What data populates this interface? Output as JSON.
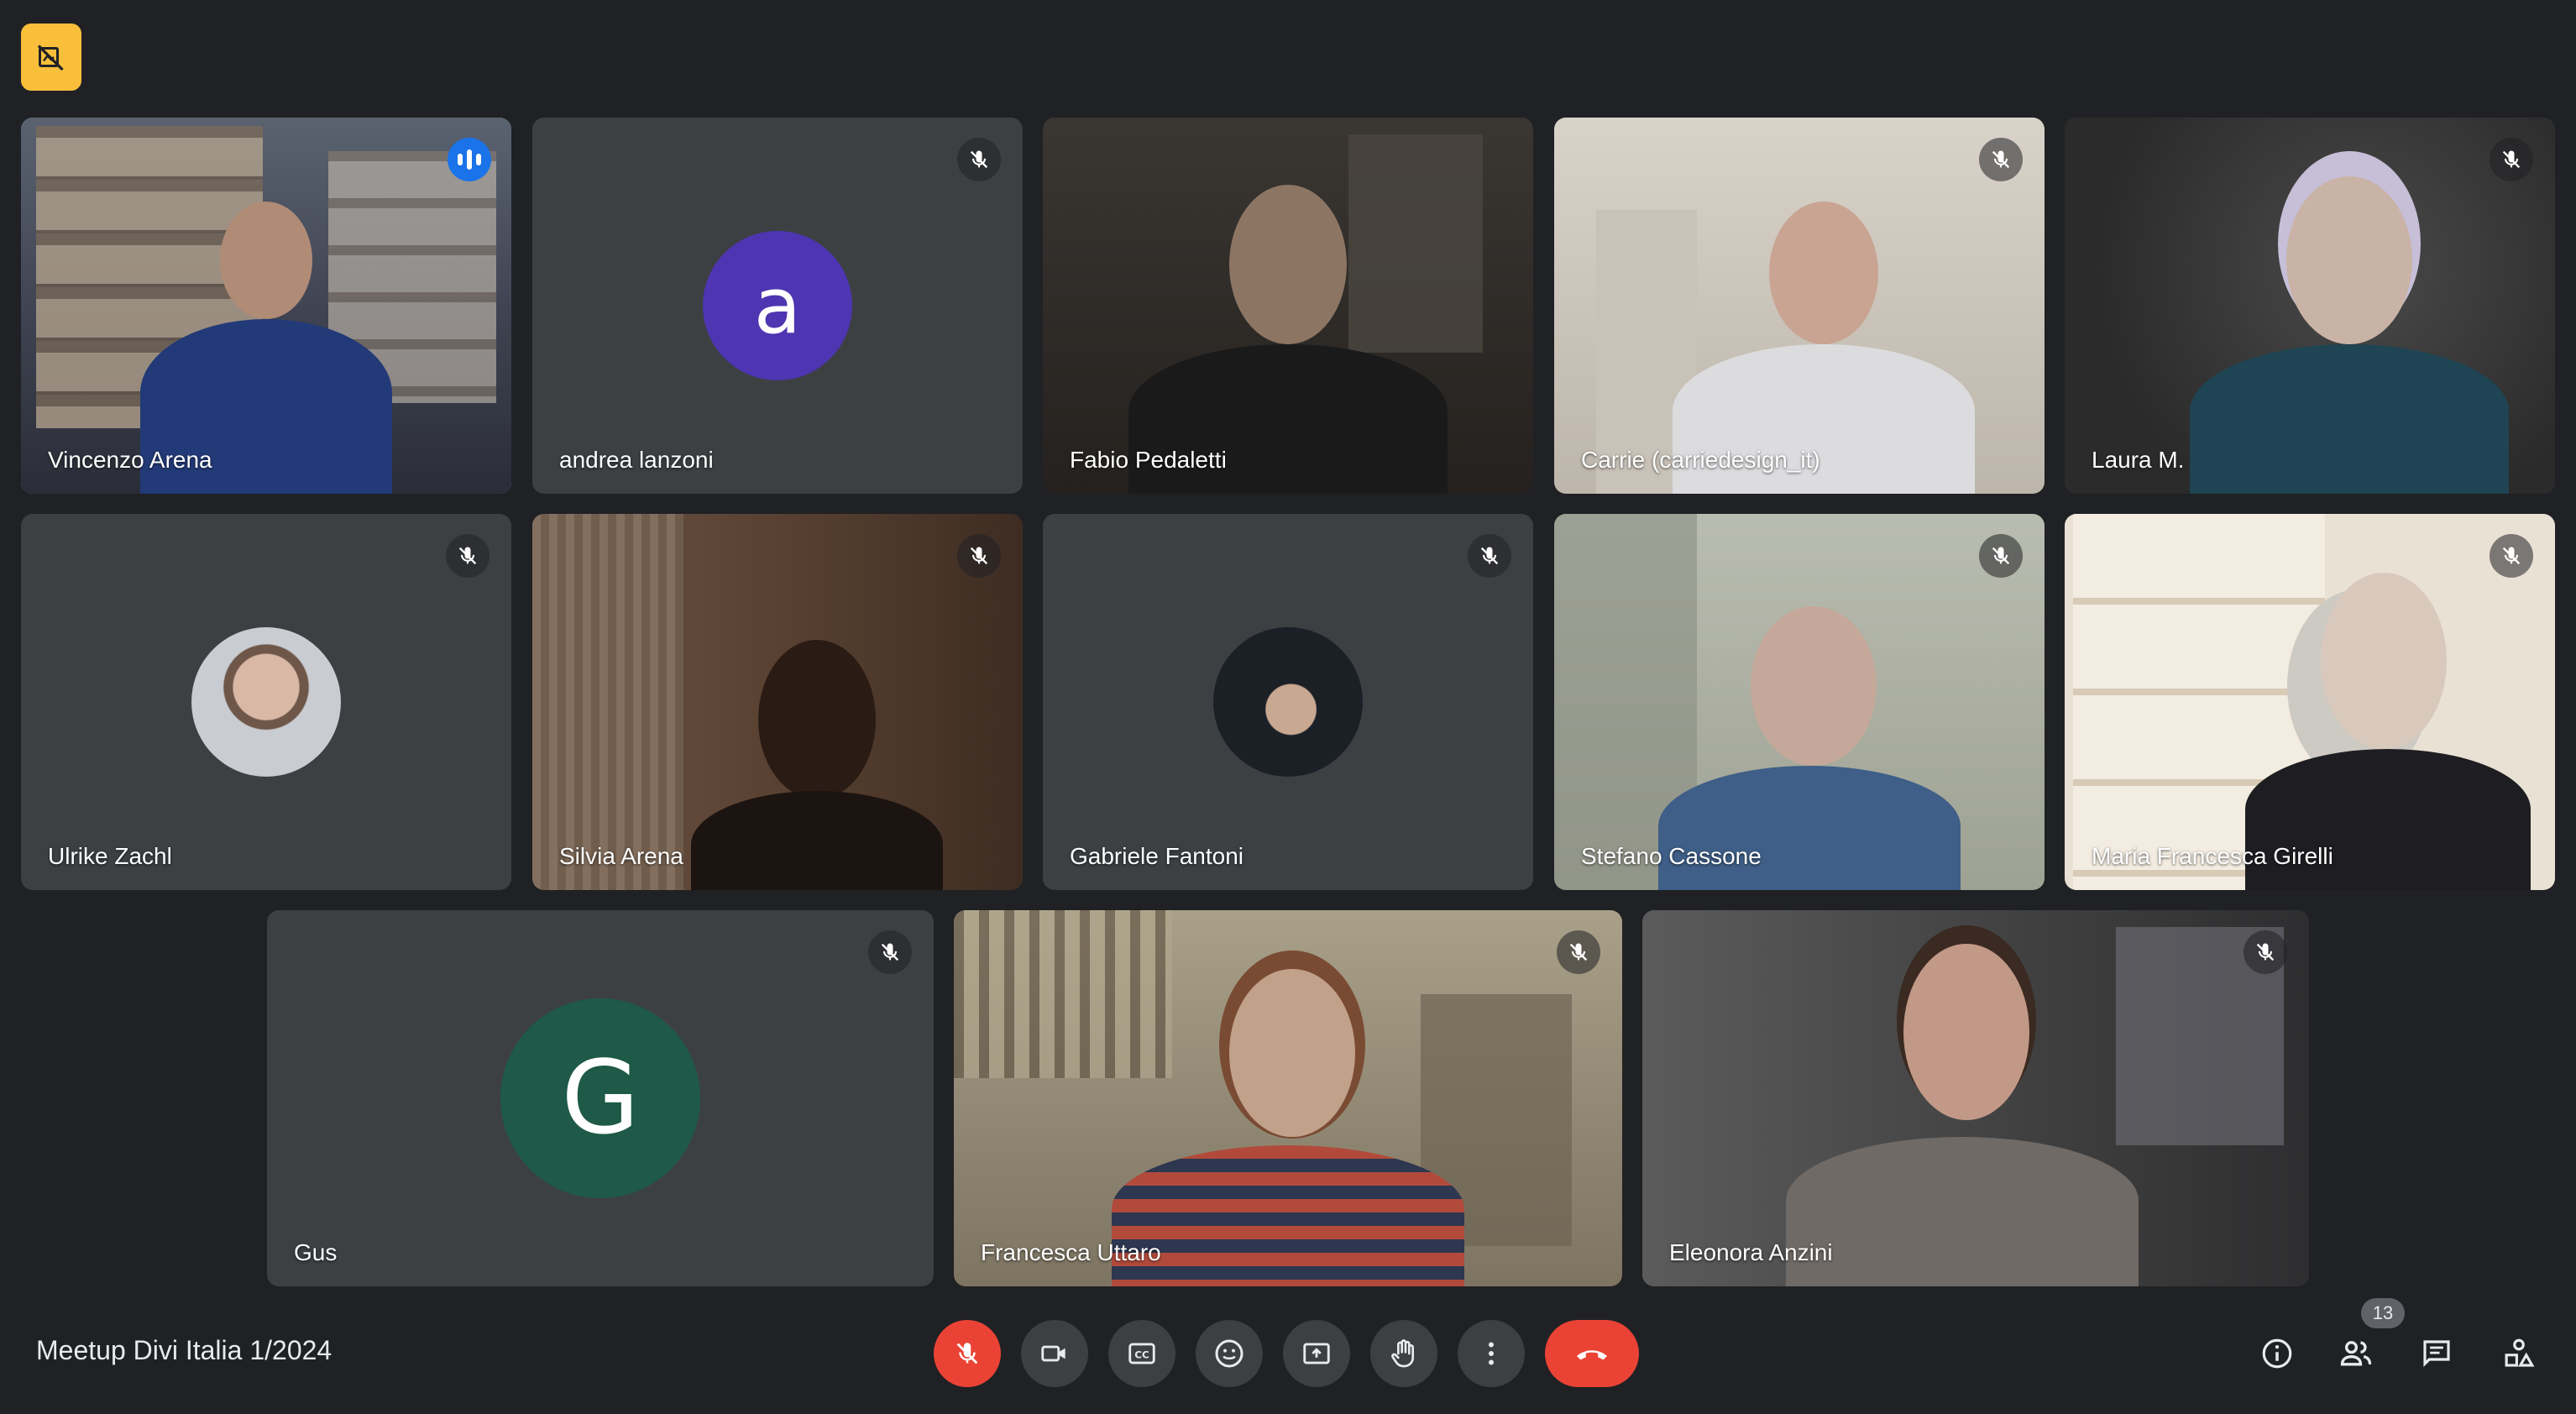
{
  "meeting": {
    "title": "Meetup Divi Italia 1/2024",
    "participant_count": "13"
  },
  "participants": [
    {
      "name": "Vincenzo Arena",
      "state": "speaking"
    },
    {
      "name": "andrea lanzoni",
      "state": "muted",
      "avatar_letter": "a",
      "avatar_color": "#4e35b1"
    },
    {
      "name": "Fabio Pedaletti",
      "state": "muted"
    },
    {
      "name": "Carrie (carriedesign_it)",
      "state": "muted"
    },
    {
      "name": "Laura M.",
      "state": "muted"
    },
    {
      "name": "Ulrike Zachl",
      "state": "muted"
    },
    {
      "name": "Silvia Arena",
      "state": "muted"
    },
    {
      "name": "Gabriele Fantoni",
      "state": "muted"
    },
    {
      "name": "Stefano Cassone",
      "state": "muted"
    },
    {
      "name": "Maria Francesca Girelli",
      "state": "muted"
    },
    {
      "name": "Gus",
      "state": "muted",
      "avatar_letter": "G",
      "avatar_color": "#1e5a47"
    },
    {
      "name": "Francesca Uttaro",
      "state": "muted"
    },
    {
      "name": "Eleonora Anzini",
      "state": "muted"
    }
  ],
  "controls": {
    "center": [
      "mic-off-icon",
      "camera-icon",
      "captions-icon",
      "emoji-icon",
      "present-icon",
      "raise-hand-icon",
      "more-options-icon",
      "end-call-icon"
    ],
    "right": [
      "info-icon",
      "people-icon",
      "chat-icon",
      "activities-icon"
    ]
  },
  "colors": {
    "background": "#202124",
    "tile": "#3c4043",
    "speaking_ring": "#8ab4f8",
    "speaking_indicator": "#1a73e8",
    "end_call": "#ea4335",
    "badge": "#f9bf3b"
  }
}
